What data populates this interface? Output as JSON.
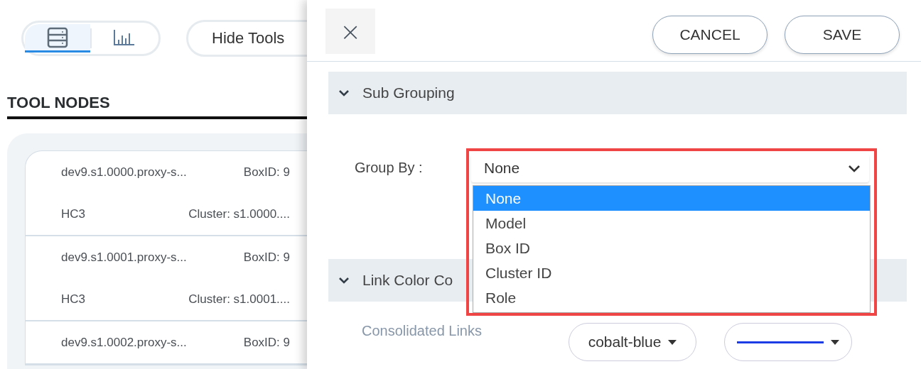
{
  "view_toggle": [
    {
      "kind": "list",
      "selected": true
    },
    {
      "kind": "chart",
      "selected": false
    }
  ],
  "hide_tools_button": "Hide Tools",
  "section_title": "TOOL NODES",
  "nodes": [
    {
      "name": "dev9.s1.0000.proxy-s...",
      "box_id": "BoxID: 9",
      "model": "HC3",
      "cluster": "Cluster: s1.0000...."
    },
    {
      "name": "dev9.s1.0001.proxy-s...",
      "box_id": "BoxID: 9",
      "model": "HC3",
      "cluster": "Cluster: s1.0001...."
    },
    {
      "name": "dev9.s1.0002.proxy-s...",
      "box_id": "BoxID: 9"
    }
  ],
  "drawer": {
    "close": "×",
    "buttons": [
      "CANCEL",
      "SAVE"
    ],
    "sections": [
      {
        "title": "Sub Grouping",
        "expanded": true
      },
      {
        "title": "Link Color Co",
        "expanded": true
      }
    ],
    "group_by": {
      "label": "Group By :",
      "value": "None",
      "open": true,
      "options": [
        {
          "label": "None",
          "selected": true
        },
        {
          "label": "Model",
          "selected": false
        },
        {
          "label": "Box ID",
          "selected": false
        },
        {
          "label": "Cluster ID",
          "selected": false
        },
        {
          "label": "Role",
          "selected": false
        }
      ]
    },
    "consolidated_links": {
      "label": "Consolidated Links",
      "color_value": "cobalt-blue"
    }
  }
}
